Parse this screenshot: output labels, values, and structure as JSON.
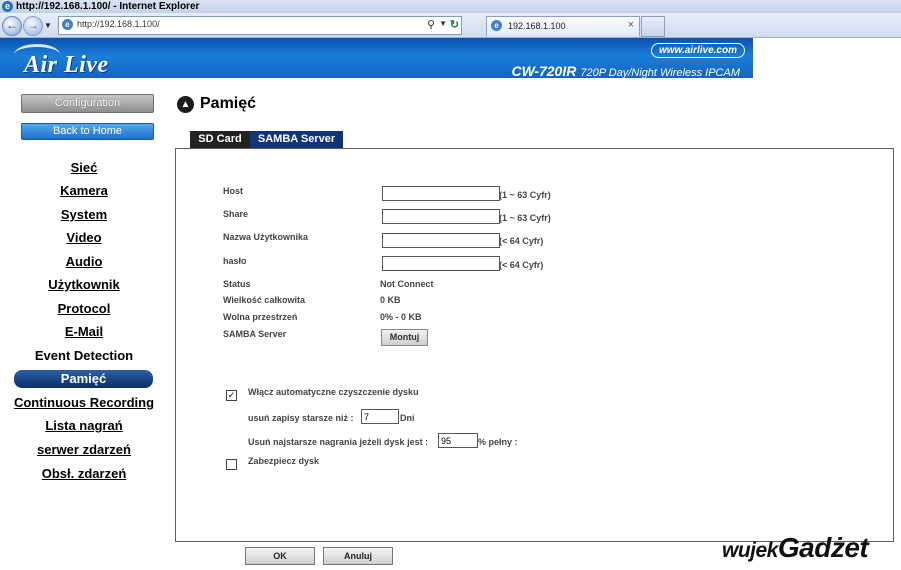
{
  "window": {
    "title": "http://192.168.1.100/ - Internet Explorer"
  },
  "browser": {
    "url": "http://192.168.1.100/",
    "tab_label": "192.168.1.100",
    "icons": {
      "back": "back-arrow-icon",
      "forward": "forward-arrow-icon",
      "search": "search-icon",
      "refresh": "refresh-icon",
      "close": "close-icon"
    }
  },
  "banner": {
    "logo": "Air Live",
    "website": "www.airlive.com",
    "model": "CW-720IR",
    "model_desc": "720P Day/Night Wireless IPCAM",
    "color_start": "#0b52b0",
    "color_end": "#1a7ed9"
  },
  "sidebar": {
    "configuration": "Configuration",
    "back_home": "Back to Home",
    "items": [
      {
        "label": "Sieć"
      },
      {
        "label": "Kamera"
      },
      {
        "label": "System"
      },
      {
        "label": "Video"
      },
      {
        "label": "Audio"
      },
      {
        "label": "Użytkownik"
      },
      {
        "label": "Protocol"
      },
      {
        "label": "E-Mail"
      },
      {
        "label": "Event Detection"
      },
      {
        "label": "Pamięć"
      },
      {
        "label": "Continuous Recording"
      },
      {
        "label": "Lista nagrań"
      },
      {
        "label": "serwer zdarzeń"
      },
      {
        "label": "Obsł. zdarzeń"
      }
    ],
    "active_index": 9,
    "active_color": "#0c2f66"
  },
  "main": {
    "title": "Pamięć",
    "tabs": [
      {
        "label": "SD Card"
      },
      {
        "label": "SAMBA Server"
      }
    ],
    "active_tab": 1,
    "fields": [
      {
        "label": "Host",
        "value": "",
        "hint": "(1 ~ 63 Cyfr)"
      },
      {
        "label": "Share",
        "value": "",
        "hint": "(1 ~ 63 Cyfr)"
      },
      {
        "label": "Nazwa Użytkownika",
        "value": "",
        "hint": "(< 64 Cyfr)"
      },
      {
        "label": "hasło",
        "value": "",
        "hint": "(< 64 Cyfr)"
      }
    ],
    "info": [
      {
        "label": "Status",
        "value": "Not Connect"
      },
      {
        "label": "Wielkość całkowita",
        "value": "0 KB"
      },
      {
        "label": "Wolna przestrzeń",
        "value": "0% - 0 KB"
      }
    ],
    "samba_label": "SAMBA Server",
    "mount_button": "Montuj",
    "auto_clean": {
      "checked": true,
      "label": "Włącz automatyczne czyszczenie dysku",
      "older_label": "usuń zapisy starsze niż :",
      "older_value": "7",
      "older_unit": "Dni",
      "full_label": "Usuń najstarsze nagrania jeżeli dysk jest :",
      "full_value": "95",
      "full_unit": "% pełny :"
    },
    "protect": {
      "checked": false,
      "label": "Zabezpiecz dysk"
    },
    "ok_button": "OK",
    "cancel_button": "Anuluj"
  },
  "watermark": {
    "part1": "wujek",
    "part2": "Gadżet"
  }
}
